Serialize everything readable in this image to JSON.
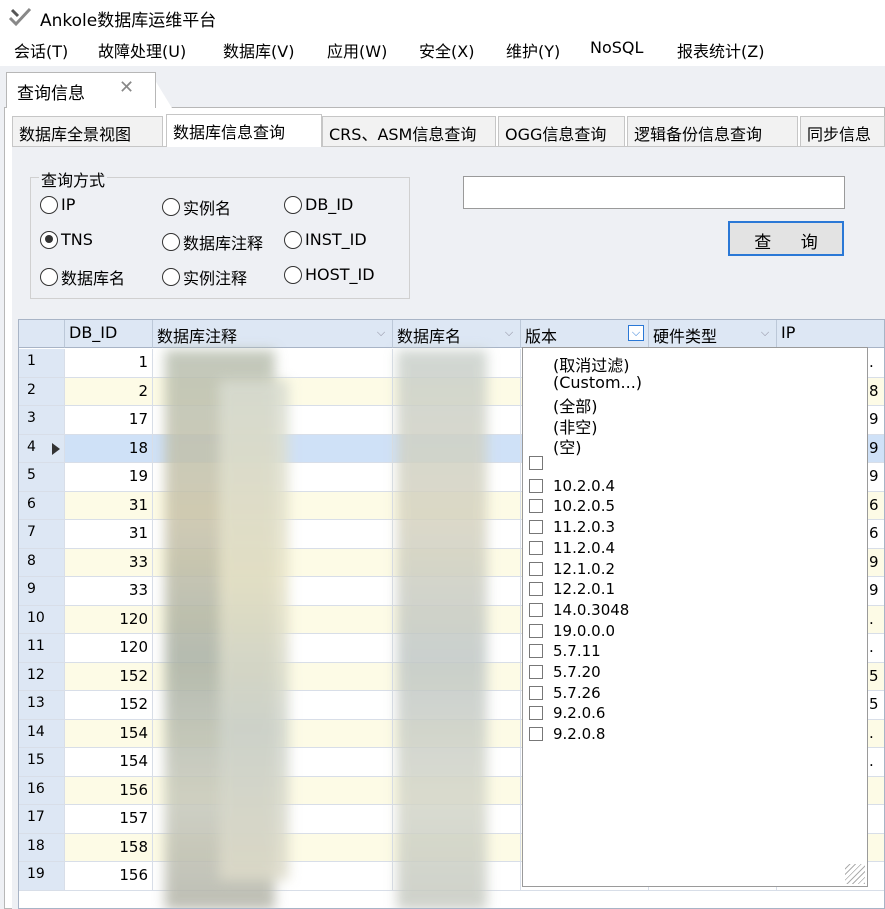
{
  "window": {
    "title": "Ankole数据库运维平台",
    "logo_icon": "ankole-logo-icon"
  },
  "menu": [
    "会话(T)",
    "故障处理(U)",
    "数据库(V)",
    "应用(W)",
    "安全(X)",
    "维护(Y)",
    "NoSQL",
    "报表统计(Z)"
  ],
  "doc_tab": {
    "label": "查询信息",
    "close": "✕"
  },
  "inner_tabs": [
    "数据库全景视图",
    "数据库信息查询",
    "CRS、ASM信息查询",
    "OGG信息查询",
    "逻辑备份信息查询",
    "同步信息"
  ],
  "query": {
    "group_label": "查询方式",
    "options": [
      "IP",
      "实例名",
      "DB_ID",
      "TNS",
      "数据库注释",
      "INST_ID",
      "数据库名",
      "实例注释",
      "HOST_ID"
    ],
    "selected": "TNS",
    "search_value": "",
    "query_button": "查 询"
  },
  "grid": {
    "columns": [
      "DB_ID",
      "数据库注释",
      "数据库名",
      "版本",
      "硬件类型",
      "IP"
    ],
    "rows": [
      {
        "n": "1",
        "db_id": "1"
      },
      {
        "n": "2",
        "db_id": "2"
      },
      {
        "n": "3",
        "db_id": "17"
      },
      {
        "n": "4",
        "db_id": "18"
      },
      {
        "n": "5",
        "db_id": "19"
      },
      {
        "n": "6",
        "db_id": "31"
      },
      {
        "n": "7",
        "db_id": "31"
      },
      {
        "n": "8",
        "db_id": "33"
      },
      {
        "n": "9",
        "db_id": "33"
      },
      {
        "n": "10",
        "db_id": "120"
      },
      {
        "n": "11",
        "db_id": "120"
      },
      {
        "n": "12",
        "db_id": "152"
      },
      {
        "n": "13",
        "db_id": "152"
      },
      {
        "n": "14",
        "db_id": "154"
      },
      {
        "n": "15",
        "db_id": "154"
      },
      {
        "n": "16",
        "db_id": "156"
      },
      {
        "n": "17",
        "db_id": "157"
      },
      {
        "n": "18",
        "db_id": "158"
      },
      {
        "n": "19",
        "db_id": "156"
      }
    ],
    "ip_fragments": [
      ".",
      "8",
      "9",
      "9",
      "9",
      "6",
      "6",
      "9",
      "9",
      ".",
      ".",
      "5",
      "5",
      ".",
      ".",
      "",
      "",
      "",
      ""
    ]
  },
  "filter_popup": {
    "specials": [
      "(取消过滤)",
      "(Custom...)",
      "(全部)",
      "(非空)",
      "(空)"
    ],
    "values": [
      "",
      "10.2.0.4",
      "10.2.0.5",
      "11.2.0.3",
      "11.2.0.4",
      "12.1.0.2",
      "12.2.0.1",
      "14.0.3048",
      "19.0.0.0",
      "5.7.11",
      "5.7.20",
      "5.7.26",
      "9.2.0.6",
      "9.2.0.8"
    ]
  },
  "colors": {
    "accent": "#2a78d6",
    "header_bg": "#dde7f4",
    "stripe": "#fdfbe6",
    "selected_row": "#cfe1f7"
  }
}
